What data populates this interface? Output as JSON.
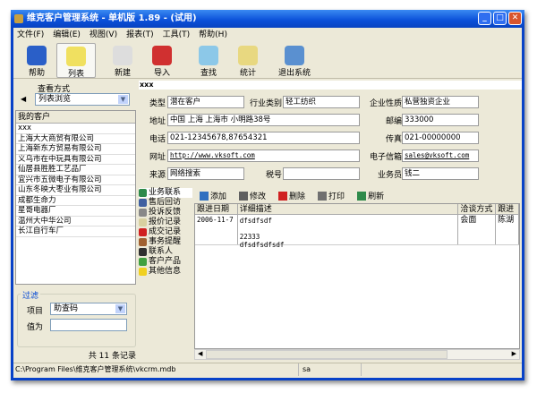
{
  "window": {
    "title": "维克客户管理系统 - 单机版 1.89 - (试用)"
  },
  "menu": [
    "文件(F)",
    "编辑(E)",
    "视图(V)",
    "报表(T)",
    "工具(T)",
    "帮助(H)"
  ],
  "toolbar": [
    {
      "label": "帮助",
      "icon": "help-book-icon",
      "color": "#2a5fc8"
    },
    {
      "label": "列表",
      "icon": "list-pin-icon",
      "color": "#f0e060"
    },
    {
      "label": "新建",
      "icon": "new-note-icon",
      "color": "#ddd"
    },
    {
      "label": "导入",
      "icon": "import-tray-icon",
      "color": "#d03030"
    },
    {
      "label": "查找",
      "icon": "magnifier-icon",
      "color": "#8cc8e8"
    },
    {
      "label": "统计",
      "icon": "stats-pencil-icon",
      "color": "#e8d880"
    },
    {
      "label": "退出系统",
      "icon": "exit-icon",
      "color": "#5a90d0"
    }
  ],
  "left": {
    "view_label": "查看方式",
    "view_value": "列表浏览",
    "list_header": "我的客户",
    "customers": [
      "xxx",
      "上海大大商贸有限公司",
      "上海新东方贸易有限公司",
      "义乌市在中玩具有限公司",
      "仙居县胜胜工艺品厂",
      "宜兴市五微电子有限公司",
      "山东冬映大枣业有限公司",
      "成都生命力",
      "星哥电器厂",
      "温州大中华公司",
      "长江自行车厂"
    ],
    "filter_legend": "过滤",
    "filter_item_label": "项目",
    "filter_item_value": "助查码",
    "filter_value_label": "值为",
    "filter_value": "",
    "count": "共 11 条记录"
  },
  "detail": {
    "name": "xxx",
    "type_label": "类型",
    "type": "潜在客户",
    "industry_label": "行业类别",
    "industry": "轻工纺织",
    "nature_label": "企业性质",
    "nature": "私营独资企业",
    "address_label": "地址",
    "address": "中国 上海 上海市 小明路38号",
    "zip_label": "邮编",
    "zip": "333000",
    "phone_label": "电话",
    "phone": "021-12345678,87654321",
    "fax_label": "传真",
    "fax": "021-00000000",
    "web_label": "网址",
    "web": "http://www.vksoft.com",
    "email_label": "电子信箱",
    "email": "sales@vksoft.com",
    "source_label": "来源",
    "source": "网络搜索",
    "tax_label": "税号",
    "tax": "",
    "sales_label": "业务员",
    "sales": "钱二"
  },
  "tabs": [
    {
      "label": "业务联系",
      "color": "#2e8a4a"
    },
    {
      "label": "售后回访",
      "color": "#4060a0"
    },
    {
      "label": "投诉反馈",
      "color": "#888"
    },
    {
      "label": "报价记录",
      "color": "#d8d0a0"
    },
    {
      "label": "成交记录",
      "color": "#d02020"
    },
    {
      "label": "事务提醒",
      "color": "#a06030"
    },
    {
      "label": "联系人",
      "color": "#303030"
    },
    {
      "label": "客户产品",
      "color": "#40a040"
    },
    {
      "label": "其他信息",
      "color": "#f0d020"
    }
  ],
  "actions": [
    {
      "label": "添加",
      "color": "#3070c0"
    },
    {
      "label": "修改",
      "color": "#606060"
    },
    {
      "label": "删除",
      "color": "#d02020"
    },
    {
      "label": "打印",
      "color": "#707070"
    },
    {
      "label": "刷新",
      "color": "#2e8a4a"
    }
  ],
  "grid": {
    "columns": [
      "跟进日期",
      "详细描述",
      "洽谈方式",
      "跟进"
    ],
    "rows": [
      {
        "date": "2006-11-7",
        "desc1": "dfsdfsdf",
        "desc2": "22333",
        "desc3": "dfsdfsdfsdf",
        "method": "会面",
        "by": "陈湖"
      }
    ]
  },
  "status": {
    "path": "C:\\Program Files\\维克客户管理系统\\vkcrm.mdb",
    "user": "sa"
  }
}
